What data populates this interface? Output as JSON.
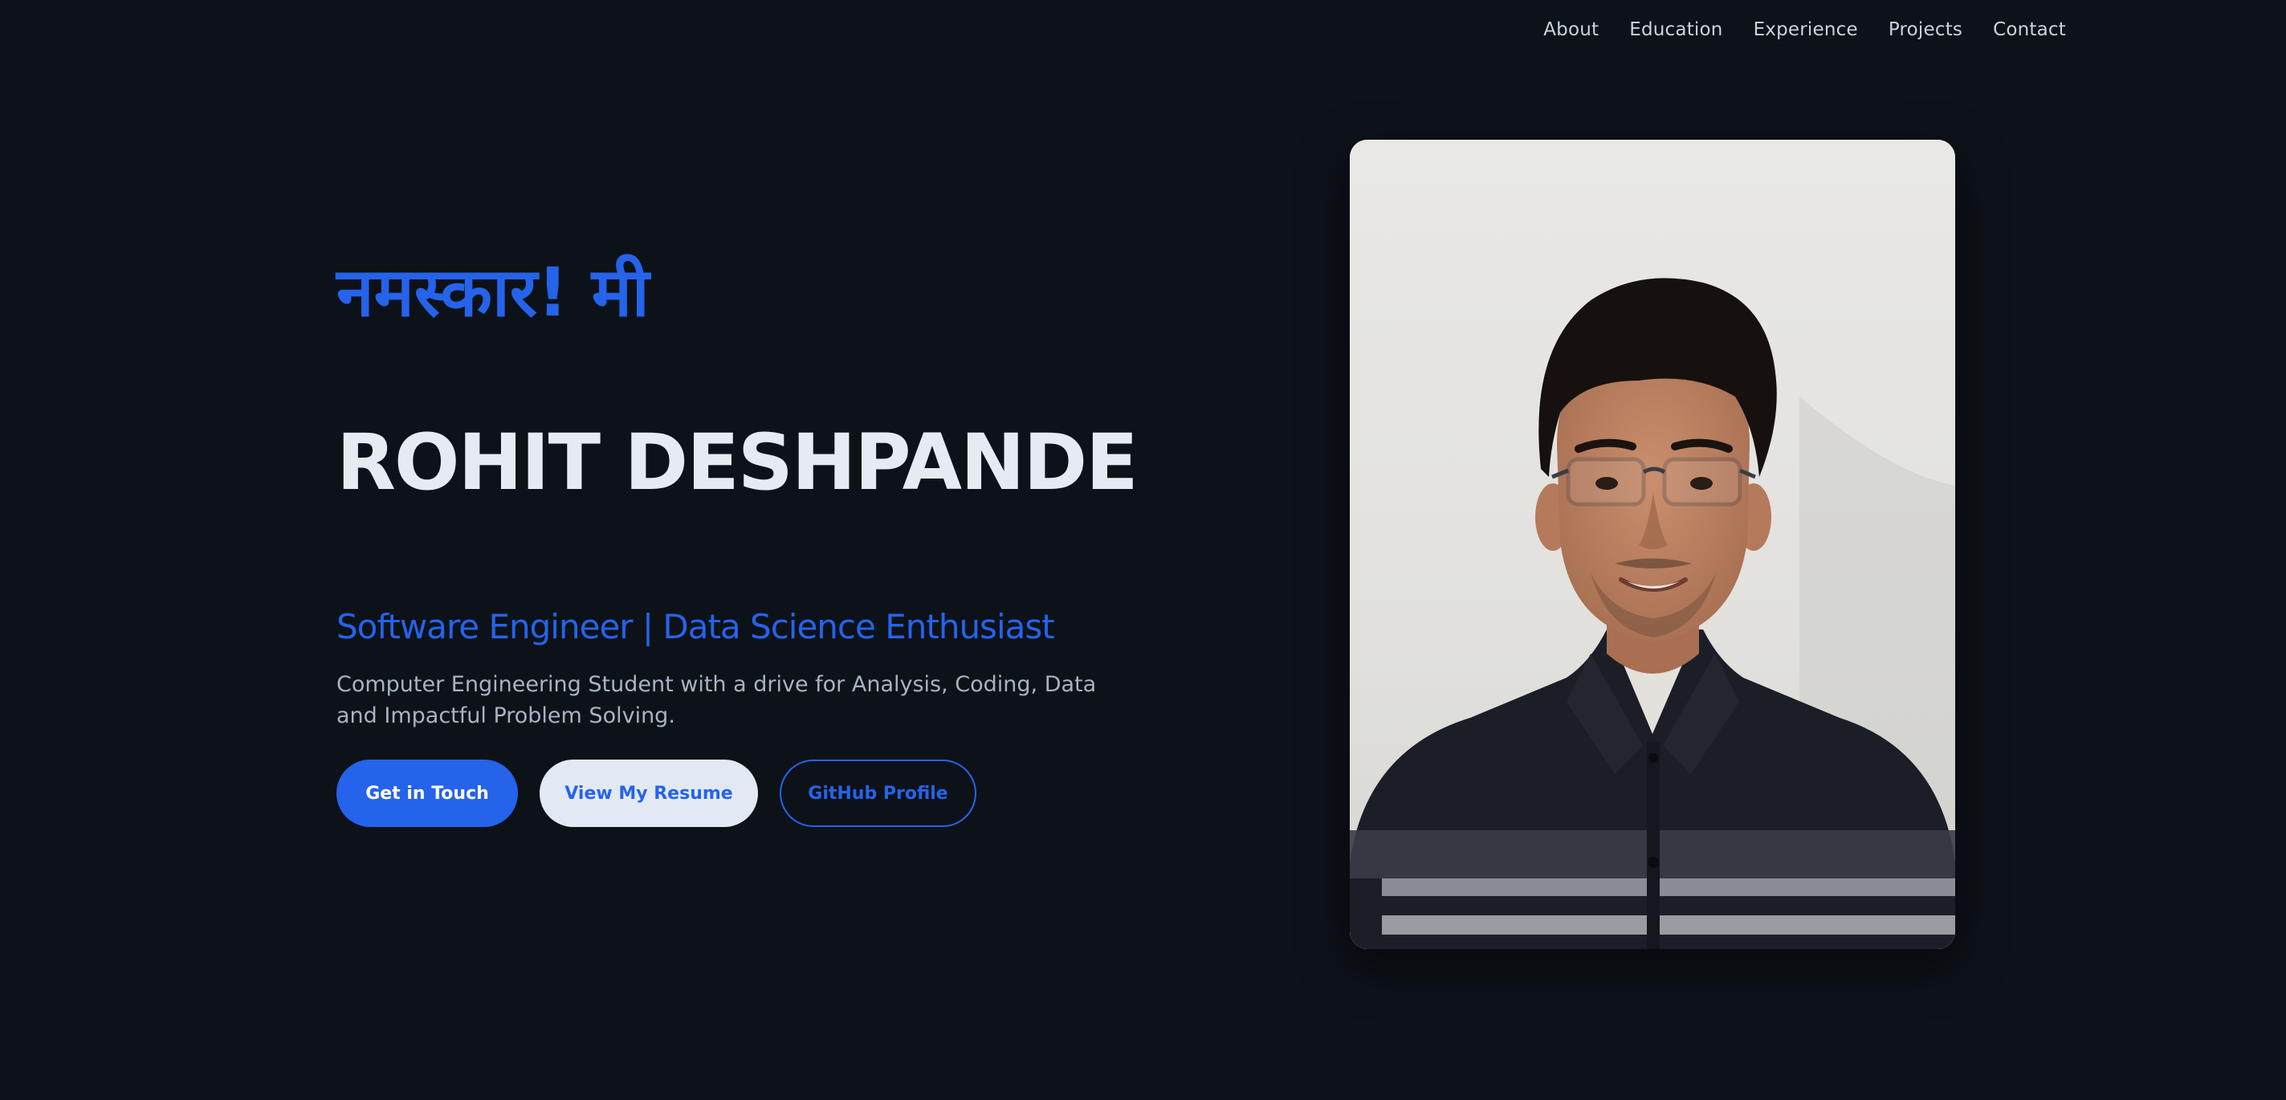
{
  "nav": {
    "items": [
      {
        "label": "About"
      },
      {
        "label": "Education"
      },
      {
        "label": "Experience"
      },
      {
        "label": "Projects"
      },
      {
        "label": "Contact"
      }
    ]
  },
  "hero": {
    "greeting": "नमस्कार! मी",
    "name": "ROHIT DESHPANDE",
    "role": "Software Engineer | Data Science Enthusiast",
    "description": "Computer Engineering Student with a drive for Analysis, Coding, Data and Impactful Problem Solving.",
    "buttons": {
      "contact_label": "Get in Touch",
      "resume_label": "View My Resume",
      "github_label": "GitHub Profile"
    }
  },
  "theme": {
    "background": "#0d1219",
    "accent": "#2563eb",
    "heading": "#e6ebf2",
    "muted": "#a7b3c3"
  }
}
